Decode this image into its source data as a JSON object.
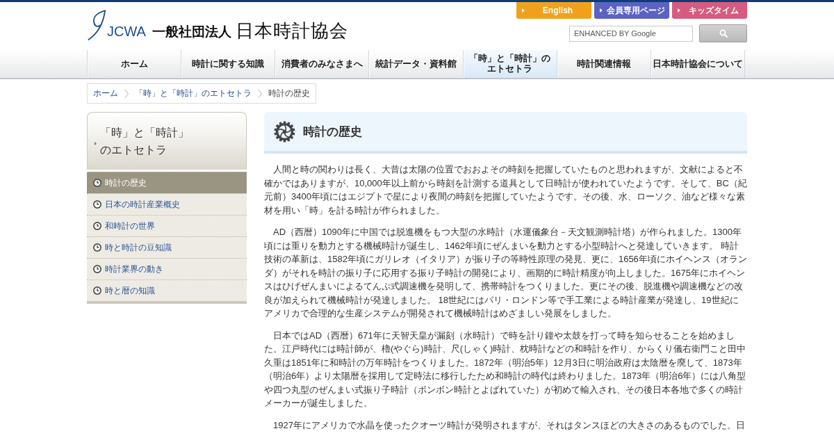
{
  "header": {
    "logo": {
      "abbr": "JCWA",
      "prefix": "一般社団法人",
      "name": "日本時計協会"
    },
    "top_links": [
      {
        "label": "English",
        "color": "#f0a11c"
      },
      {
        "label": "会員専用ページ",
        "color": "#5a62c3"
      },
      {
        "label": "キッズタイム",
        "color": "#d65b80"
      }
    ],
    "search": {
      "placeholder": "ENHANCED BY Google"
    }
  },
  "nav": [
    {
      "label": "ホーム",
      "selected": false
    },
    {
      "label": "時計に関する知識",
      "selected": false
    },
    {
      "label": "消費者のみなさまへ",
      "selected": false
    },
    {
      "label": "統計データ・資料館",
      "selected": false
    },
    {
      "label": "「時」と「時計」のエトセトラ",
      "selected": true
    },
    {
      "label": "時計関連情報",
      "selected": false
    },
    {
      "label": "日本時計協会について",
      "selected": false
    }
  ],
  "breadcrumb": [
    {
      "label": "ホーム",
      "kind": "link"
    },
    {
      "label": "「時」と「時計」のエトセトラ",
      "kind": "link"
    },
    {
      "label": "時計の歴史",
      "kind": "current"
    }
  ],
  "sidebar": {
    "title": "「時」と「時計」のエトセトラ",
    "items": [
      {
        "label": "時計の歴史",
        "selected": true
      },
      {
        "label": "日本の時計産業概史",
        "selected": false
      },
      {
        "label": "和時計の世界",
        "selected": false
      },
      {
        "label": "時と時計の豆知識",
        "selected": false
      },
      {
        "label": "時計業界の動き",
        "selected": false
      },
      {
        "label": "時と暦の知識",
        "selected": false
      }
    ]
  },
  "article": {
    "title": "時計の歴史",
    "paragraphs": [
      "人間と時の関わりは長く、大昔は太陽の位置でおおよその時刻を把握していたものと思われますが、文献によると不確かではありますが、10,000年以上前から時刻を計測する道具として日時計が使われていたようです。そして、BC（紀元前）3400年頃にはエジプトで星により夜間の時刻を把握していたようです。その後、水、ローソク、油など様々な素材を用い「時」を計る時計が作られました。",
      "AD（西暦）1090年に中国では脱進機をもつ大型の水時計（水運儀象台－天文観測時計塔）が作られました。1300年頃には重りを動力とする機械時計が誕生し、1462年頃にぜんまいを動力とする小型時計へと発達していきます。 時計技術の革新は、1582年頃にガリレオ（イタリア）が振り子の等時性原理の発見、更に、1656年頃にホイヘンス（オランダ）がそれを時計の振り子に応用する振り子時計の開発により、画期的に時計精度が向上しました。1675年にホイヘンスはひげぜんまいによるてんぷ式調速機を発明して、携帯時計をつくりました。更にその後、脱進機や調速機などの改良が加えられて機械時計が発達しました。 18世紀にはパリ・ロンドン等で手工業による時計産業が発達し、19世紀にアメリカで合理的な生産システムが開発されて機械時計はめざましい発展をしました。",
      "日本ではAD（西暦）671年に天智天皇が漏刻（水時計）で時を計り鐘や太鼓を打って時を知らせることを始めました。江戸時代には時計師が、櫓(やぐら)時計、尺(しゃく)時計、枕時計などの和時計を作り、からくり儀右衛門こと田中久重は1851年に和時計の万年時計をつくりました。1872年（明治5年）12月3日に明治政府は太陰暦を廃して、1873年（明治6年）より太陽暦を採用して定時法に移行したため和時計の時代は終わりました。1873年（明治6年）には八角型や四つ丸型のぜんまい式振り子時計（ボンボン時計とよばれていた）が初めて輸入され、その後日本各地で多くの時計メーカーが誕生しました。",
      "1927年にアメリカで水晶を使ったクオーツ時計が発明されますが、それはタンスほどの大きさのあるものでした。日"
    ]
  }
}
